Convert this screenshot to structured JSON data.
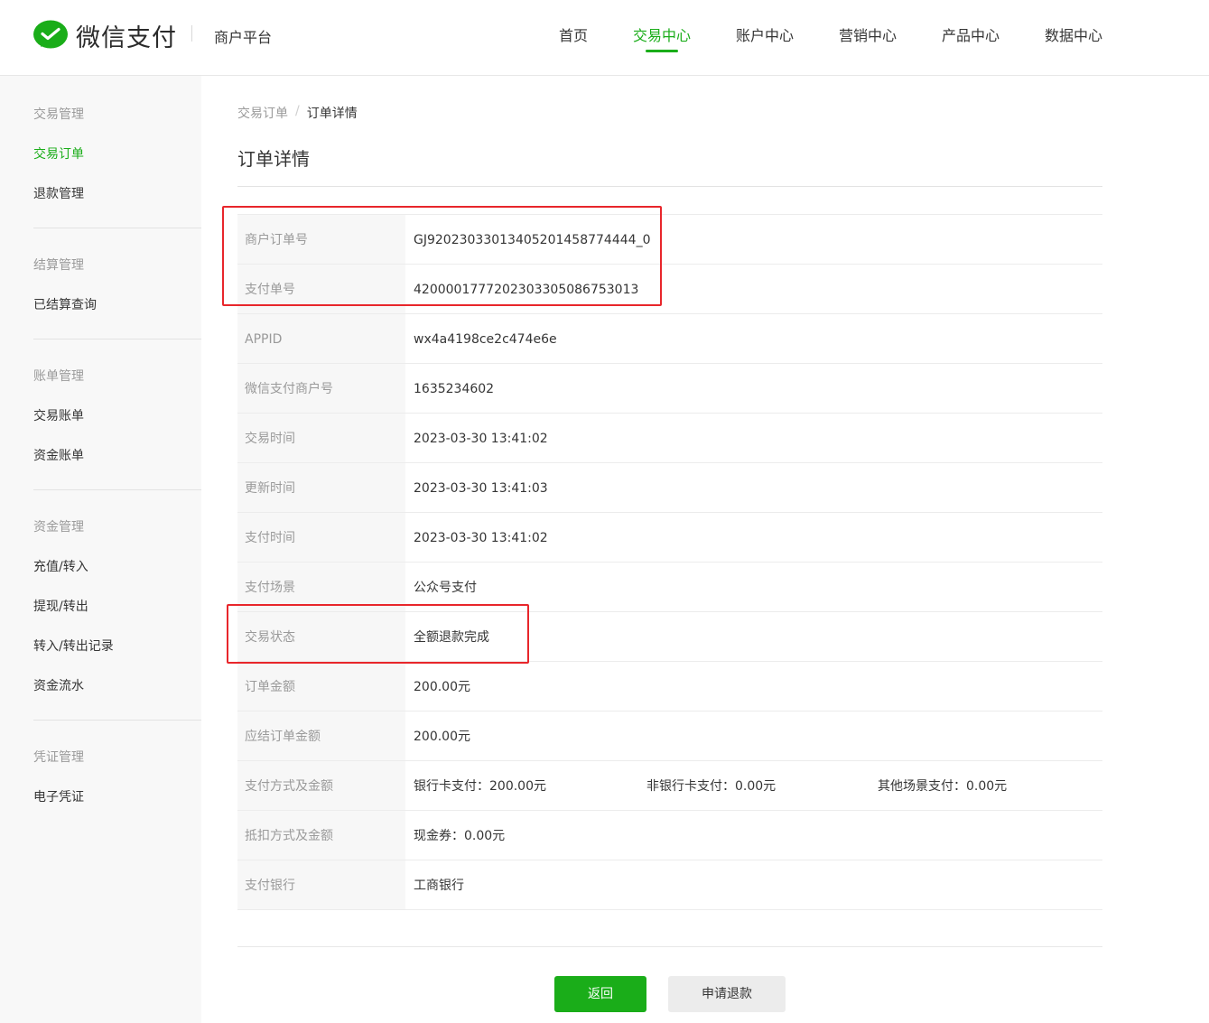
{
  "header": {
    "logo_text": "微信支付",
    "logo_icon": "wechat-pay-icon",
    "platform_name": "商户平台",
    "nav": [
      {
        "label": "首页"
      },
      {
        "label": "交易中心",
        "active": true
      },
      {
        "label": "账户中心"
      },
      {
        "label": "营销中心"
      },
      {
        "label": "产品中心"
      },
      {
        "label": "数据中心"
      }
    ]
  },
  "sidebar": {
    "groups": [
      {
        "title": "交易管理",
        "items": [
          "交易订单",
          "退款管理"
        ],
        "active_item": "交易订单"
      },
      {
        "title": "结算管理",
        "items": [
          "已结算查询"
        ]
      },
      {
        "title": "账单管理",
        "items": [
          "交易账单",
          "资金账单"
        ]
      },
      {
        "title": "资金管理",
        "items": [
          "充值/转入",
          "提现/转出",
          "转入/转出记录",
          "资金流水"
        ]
      },
      {
        "title": "凭证管理",
        "items": [
          "电子凭证"
        ]
      }
    ]
  },
  "breadcrumb": {
    "parent": "交易订单",
    "separator": "/",
    "current": "订单详情"
  },
  "page_title": "订单详情",
  "details": [
    {
      "label": "商户订单号",
      "values": [
        "GJ92023033013405201458774444_0"
      ]
    },
    {
      "label": "支付单号",
      "values": [
        "4200001777202303305086753013"
      ]
    },
    {
      "label": "APPID",
      "values": [
        "wx4a4198ce2c474e6e"
      ]
    },
    {
      "label": "微信支付商户号",
      "values": [
        "1635234602"
      ]
    },
    {
      "label": "交易时间",
      "values": [
        "2023-03-30 13:41:02"
      ]
    },
    {
      "label": "更新时间",
      "values": [
        "2023-03-30 13:41:03"
      ]
    },
    {
      "label": "支付时间",
      "values": [
        "2023-03-30 13:41:02"
      ]
    },
    {
      "label": "支付场景",
      "values": [
        "公众号支付"
      ]
    },
    {
      "label": "交易状态",
      "values": [
        "全额退款完成"
      ]
    },
    {
      "label": "订单金额",
      "values": [
        "200.00元"
      ]
    },
    {
      "label": "应结订单金额",
      "values": [
        "200.00元"
      ]
    },
    {
      "label": "支付方式及金额",
      "values": [
        "银行卡支付：200.00元",
        "非银行卡支付：0.00元",
        "其他场景支付：0.00元"
      ]
    },
    {
      "label": "抵扣方式及金额",
      "values": [
        "现金券：0.00元"
      ]
    },
    {
      "label": "支付银行",
      "values": [
        "工商银行"
      ]
    }
  ],
  "buttons": {
    "back": "返回",
    "refund": "申请退款"
  },
  "colors": {
    "accent": "#1aad19",
    "highlight": "#e8262b"
  }
}
